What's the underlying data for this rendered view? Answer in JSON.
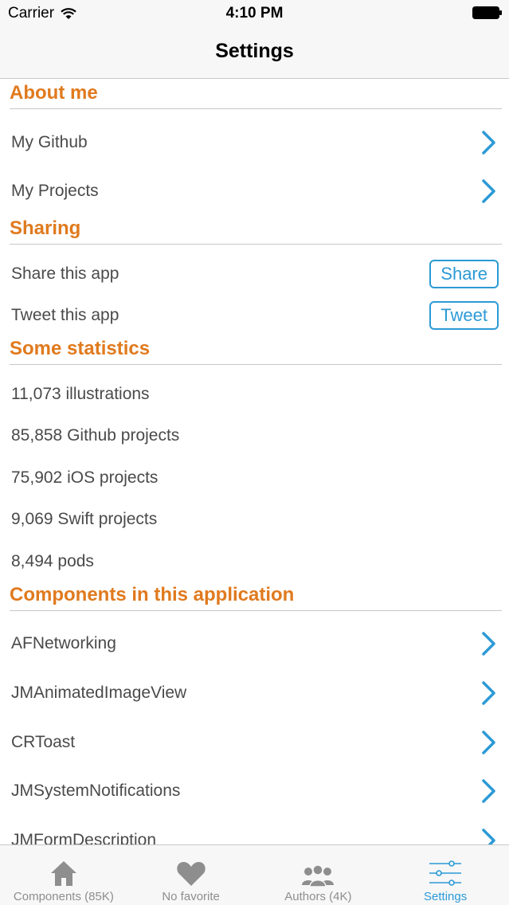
{
  "status": {
    "carrier": "Carrier",
    "time": "4:10 PM"
  },
  "nav": {
    "title": "Settings"
  },
  "sections": {
    "about": {
      "title": "About me",
      "items": [
        "My Github",
        "My Projects"
      ]
    },
    "sharing": {
      "title": "Sharing",
      "items": [
        {
          "label": "Share this app",
          "button": "Share"
        },
        {
          "label": "Tweet this app",
          "button": "Tweet"
        }
      ]
    },
    "stats": {
      "title": "Some statistics",
      "items": [
        "11,073 illustrations",
        "85,858 Github projects",
        "75,902 iOS projects",
        "9,069 Swift projects",
        "8,494 pods"
      ]
    },
    "components": {
      "title": "Components in this application",
      "items": [
        "AFNetworking",
        "JMAnimatedImageView",
        "CRToast",
        "JMSystemNotifications",
        "JMFormDescription"
      ]
    }
  },
  "tabs": [
    {
      "label": "Components (85K)",
      "icon": "house-icon"
    },
    {
      "label": "No favorite",
      "icon": "heart-icon"
    },
    {
      "label": "Authors (4K)",
      "icon": "people-icon"
    },
    {
      "label": "Settings",
      "icon": "sliders-icon",
      "active": true
    }
  ],
  "colors": {
    "accent": "#2c9ad6",
    "section": "#e07a1e"
  }
}
